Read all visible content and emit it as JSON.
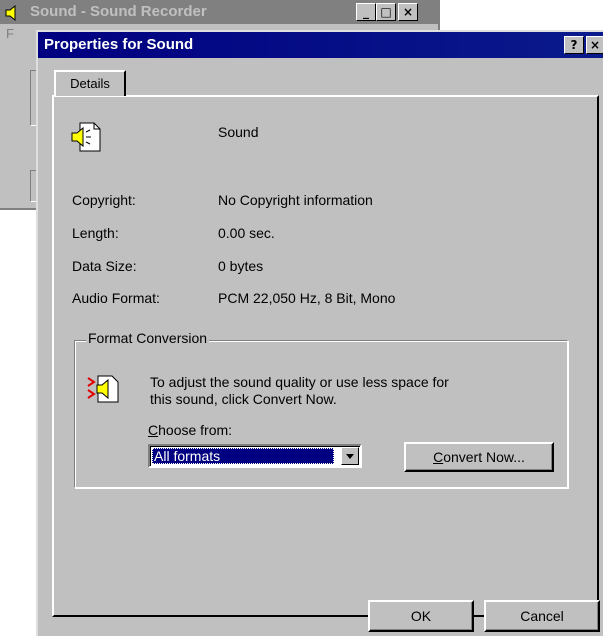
{
  "background_window": {
    "title": "Sound - Sound Recorder",
    "menu_hint": "F"
  },
  "dialog": {
    "title": "Properties for Sound",
    "help_label": "?",
    "close_label": "×"
  },
  "tabs": [
    {
      "label": "Details"
    }
  ],
  "details": {
    "file_name": "Sound",
    "rows": [
      {
        "label": "Copyright:",
        "value": "No Copyright information"
      },
      {
        "label": "Length:",
        "value": "0.00 sec."
      },
      {
        "label": "Data Size:",
        "value": "0 bytes"
      },
      {
        "label": "Audio Format:",
        "value": "PCM 22,050 Hz, 8 Bit, Mono"
      }
    ]
  },
  "format_conversion": {
    "group_label": "Format Conversion",
    "description_line1": "To adjust the sound quality or use less space for",
    "description_line2": "this sound, click Convert Now.",
    "choose_prefix": "C",
    "choose_rest": "hoose from:",
    "choose_value": "All formats",
    "convert_prefix": "C",
    "convert_rest": "onvert Now..."
  },
  "buttons": {
    "ok": "OK",
    "cancel": "Cancel"
  },
  "colors": {
    "title_active": "#000080",
    "title_inactive": "#808080",
    "face": "#c0c0c0"
  }
}
